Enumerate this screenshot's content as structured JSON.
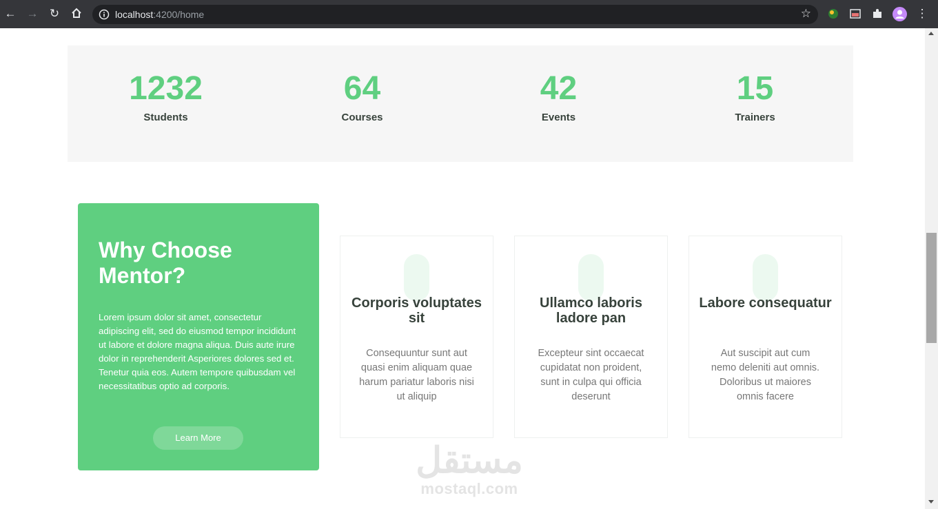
{
  "browser": {
    "url_host": "localhost",
    "url_rest": ":4200/home"
  },
  "stats": [
    {
      "number": "1232",
      "label": "Students"
    },
    {
      "number": "64",
      "label": "Courses"
    },
    {
      "number": "42",
      "label": "Events"
    },
    {
      "number": "15",
      "label": "Trainers"
    }
  ],
  "why": {
    "title": "Why Choose Mentor?",
    "text": "Lorem ipsum dolor sit amet, consectetur adipiscing elit, sed do eiusmod tempor incididunt ut labore et dolore magna aliqua. Duis aute irure dolor in reprehenderit Asperiores dolores sed et. Tenetur quia eos. Autem tempore quibusdam vel necessitatibus optio ad corporis.",
    "button_label": "Learn More"
  },
  "features": [
    {
      "title": "Corporis voluptates sit",
      "text": "Consequuntur sunt aut quasi enim aliquam quae harum pariatur laboris nisi ut aliquip"
    },
    {
      "title": "Ullamco laboris ladore pan",
      "text": "Excepteur sint occaecat cupidatat non proident, sunt in culpa qui officia deserunt"
    },
    {
      "title": "Labore consequatur",
      "text": "Aut suscipit aut cum nemo deleniti aut omnis. Doloribus ut maiores omnis facere"
    }
  ],
  "watermark": {
    "arabic": "مستقل",
    "latin": "mostaql.com"
  },
  "colors": {
    "accent": "#5fcf80",
    "chrome": "#35363a",
    "stats_bg": "#f6f6f6"
  }
}
